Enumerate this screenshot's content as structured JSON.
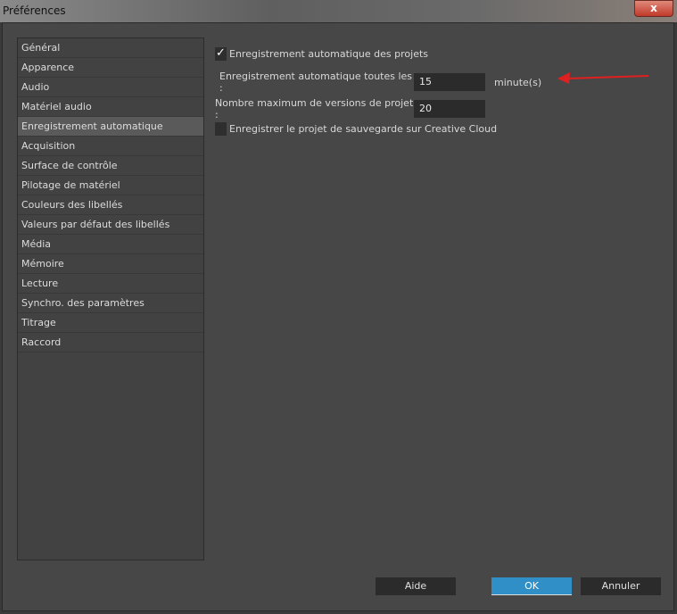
{
  "window": {
    "title": "Préférences",
    "close": "x"
  },
  "sidebar": {
    "items": [
      {
        "label": "Général"
      },
      {
        "label": "Apparence"
      },
      {
        "label": "Audio"
      },
      {
        "label": "Matériel audio"
      },
      {
        "label": "Enregistrement automatique"
      },
      {
        "label": "Acquisition"
      },
      {
        "label": "Surface de contrôle"
      },
      {
        "label": "Pilotage de matériel"
      },
      {
        "label": "Couleurs des libellés"
      },
      {
        "label": "Valeurs par défaut des libellés"
      },
      {
        "label": "Média"
      },
      {
        "label": "Mémoire"
      },
      {
        "label": "Lecture"
      },
      {
        "label": "Synchro. des paramètres"
      },
      {
        "label": "Titrage"
      },
      {
        "label": "Raccord"
      }
    ],
    "selected_index": 4
  },
  "main": {
    "autosave_checkbox": {
      "label": "Enregistrement automatique des projets",
      "checked": true,
      "mark": "✓"
    },
    "interval": {
      "label": "Enregistrement automatique toutes les :",
      "value": "15",
      "unit": "minute(s)"
    },
    "max_versions": {
      "label": "Nombre maximum de versions de projet :",
      "value": "20"
    },
    "cloud_checkbox": {
      "label": "Enregistrer le projet de sauvegarde sur Creative Cloud",
      "checked": false
    }
  },
  "annotation": {
    "arrow_color": "#e02020"
  },
  "buttons": {
    "help": "Aide",
    "ok": "OK",
    "cancel": "Annuler"
  }
}
